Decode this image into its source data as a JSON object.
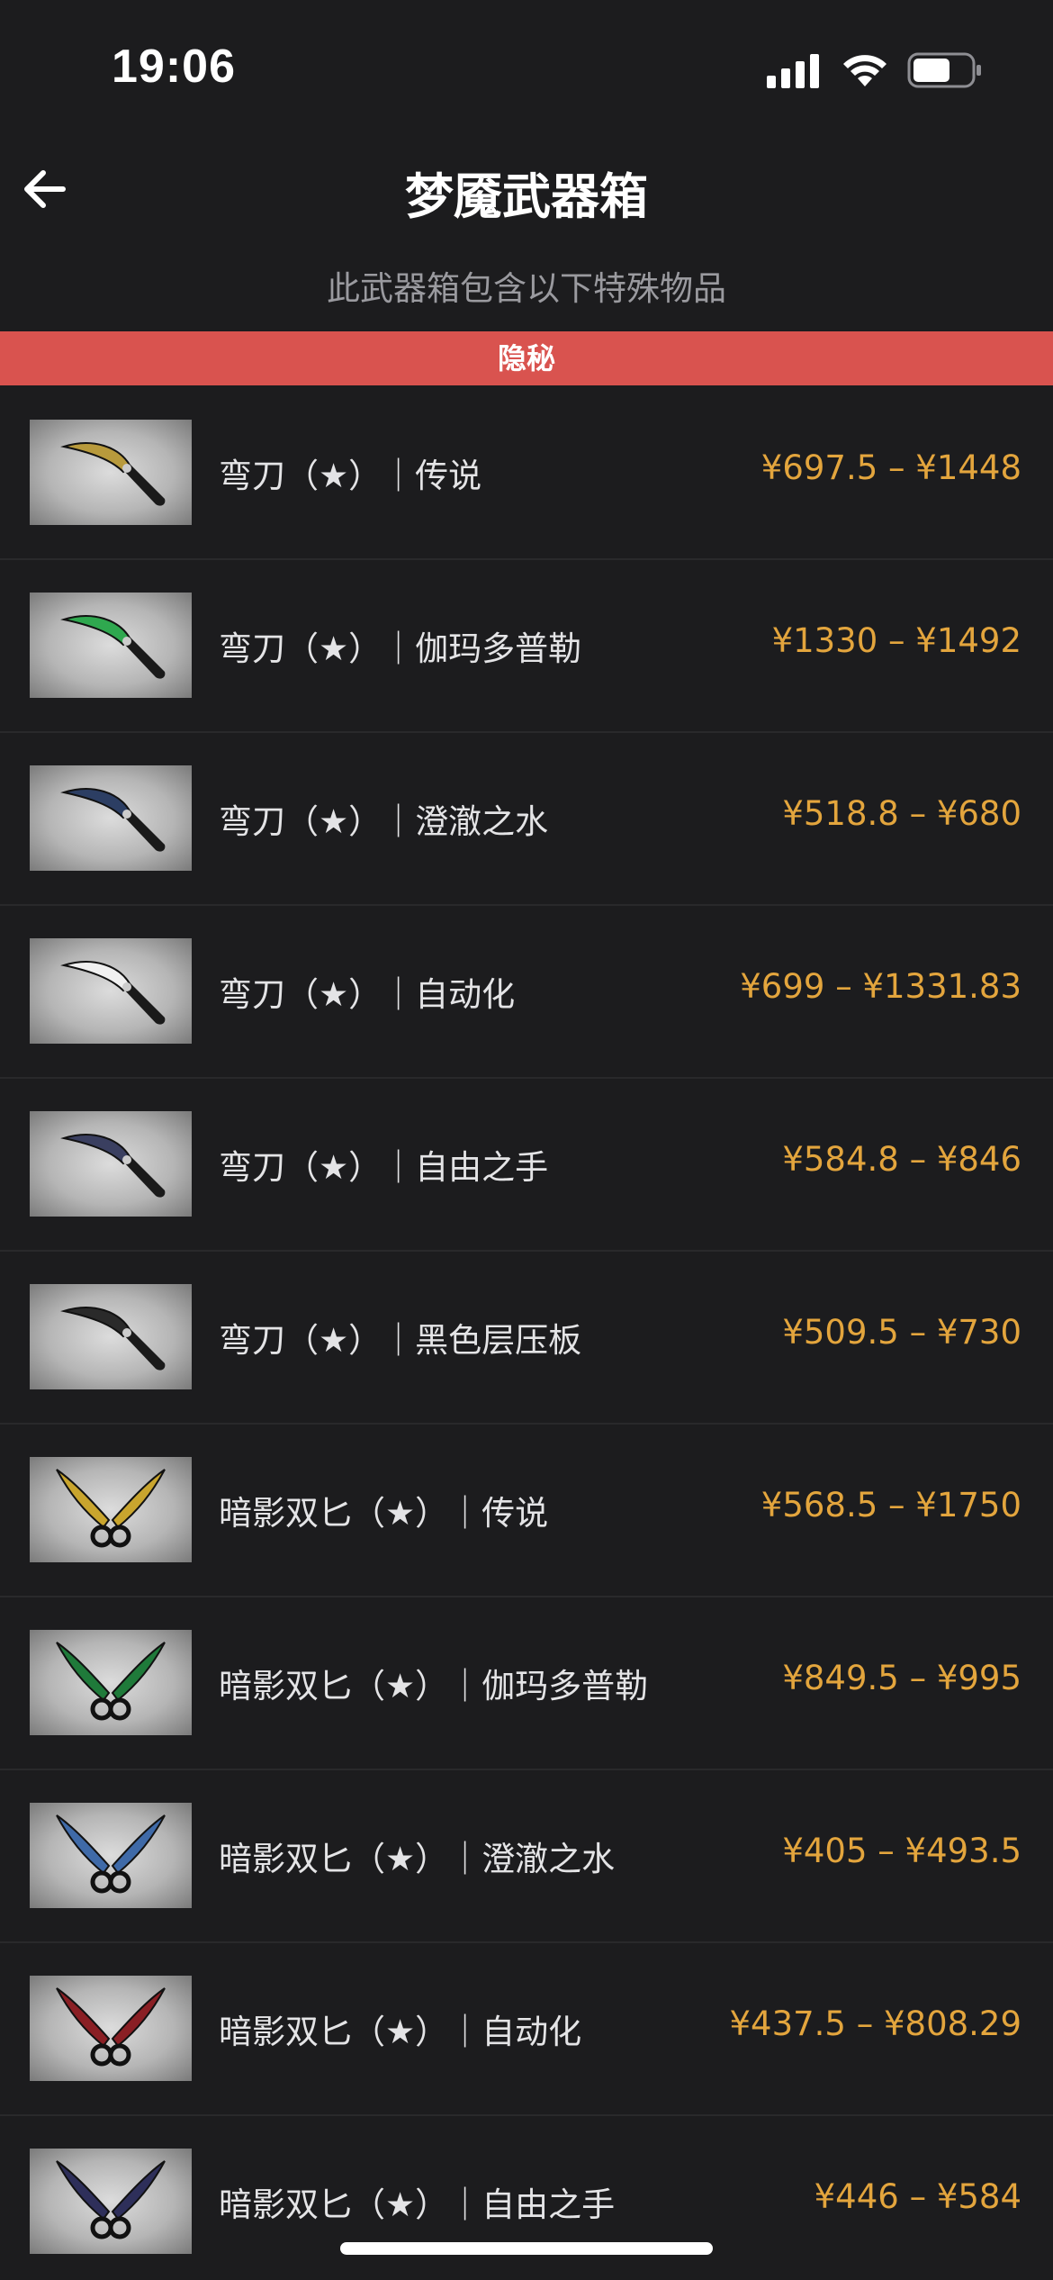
{
  "status": {
    "time": "19:06"
  },
  "header": {
    "title": "梦魇武器箱"
  },
  "subtitle": "此武器箱包含以下特殊物品",
  "rarity": {
    "label": "隐秘",
    "color": "#d9534f"
  },
  "items": [
    {
      "name": "弯刀（★）｜传说",
      "price": "¥697.5 – ¥1448",
      "icon": "falchion-knife-icon",
      "color": "#b89a3c"
    },
    {
      "name": "弯刀（★）｜伽玛多普勒",
      "price": "¥1330 – ¥1492",
      "icon": "falchion-knife-icon",
      "color": "#2fa84f"
    },
    {
      "name": "弯刀（★）｜澄澈之水",
      "price": "¥518.8 – ¥680",
      "icon": "falchion-knife-icon",
      "color": "#2c3e63"
    },
    {
      "name": "弯刀（★）｜自动化",
      "price": "¥699 – ¥1331.83",
      "icon": "falchion-knife-icon",
      "color": "#f0f0f0"
    },
    {
      "name": "弯刀（★）｜自由之手",
      "price": "¥584.8 – ¥846",
      "icon": "falchion-knife-icon",
      "color": "#3a3f60"
    },
    {
      "name": "弯刀（★）｜黑色层压板",
      "price": "¥509.5 – ¥730",
      "icon": "falchion-knife-icon",
      "color": "#2a2a2a"
    },
    {
      "name": "暗影双匕（★）｜传说",
      "price": "¥568.5 – ¥1750",
      "icon": "shadow-daggers-icon",
      "color": "#c9a52e"
    },
    {
      "name": "暗影双匕（★）｜伽玛多普勒",
      "price": "¥849.5 – ¥995",
      "icon": "shadow-daggers-icon",
      "color": "#1f7a3a"
    },
    {
      "name": "暗影双匕（★）｜澄澈之水",
      "price": "¥405 – ¥493.5",
      "icon": "shadow-daggers-icon",
      "color": "#3f6aa8"
    },
    {
      "name": "暗影双匕（★）｜自动化",
      "price": "¥437.5 – ¥808.29",
      "icon": "shadow-daggers-icon",
      "color": "#8a1f24"
    },
    {
      "name": "暗影双匕（★）｜自由之手",
      "price": "¥446 – ¥584",
      "icon": "shadow-daggers-icon",
      "color": "#2e2f5a"
    }
  ]
}
